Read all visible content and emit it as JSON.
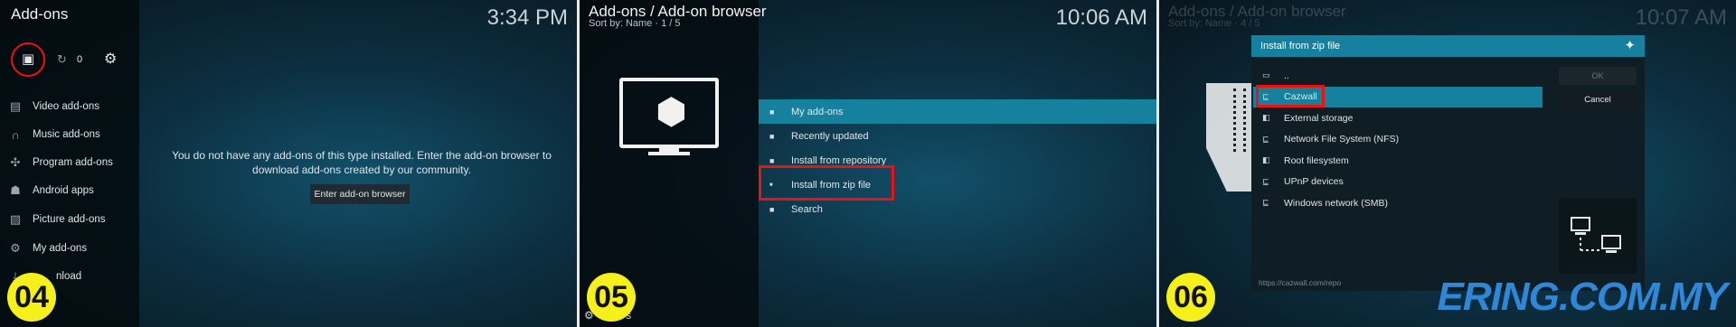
{
  "colors": {
    "accent": "#16809f",
    "highlight_red": "#e11111",
    "badge_yellow": "#f5ef1a",
    "brand_blue": "#2f87d8"
  },
  "panel1": {
    "title": "Add-ons",
    "clock": "3:34 PM",
    "update_count": "0",
    "nav": [
      {
        "label": "Video add-ons",
        "icon": "film-icon"
      },
      {
        "label": "Music add-ons",
        "icon": "headphones-icon"
      },
      {
        "label": "Program add-ons",
        "icon": "puzzle-icon"
      },
      {
        "label": "Android apps",
        "icon": "android-icon"
      },
      {
        "label": "Picture add-ons",
        "icon": "picture-icon"
      },
      {
        "label": "My add-ons",
        "icon": "gear-icon"
      },
      {
        "label": "nload",
        "icon": "download-icon"
      }
    ],
    "message": "You do not have any add-ons of this type installed. Enter the add-on browser to download add-ons created by our community.",
    "button": "Enter add-on browser",
    "step": "04"
  },
  "panel2": {
    "title": "Add-ons / Add-on browser",
    "subtitle": "Sort by: Name  ·  1 / 5",
    "clock": "10:06 AM",
    "items": [
      {
        "label": "My add-ons"
      },
      {
        "label": "Recently updated"
      },
      {
        "label": "Install from repository"
      },
      {
        "label": "Install from zip file"
      },
      {
        "label": "Search"
      }
    ],
    "bottom_fragment": "s",
    "step": "05"
  },
  "panel3": {
    "ghost_title": "Add-ons / Add-on browser",
    "ghost_subtitle": "Sort by: Name  ·  4 / 5",
    "clock": "10:07 AM",
    "dialog_title": "Install from zip file",
    "items": [
      {
        "label": ".."
      },
      {
        "label": "Cazwall"
      },
      {
        "label": "External storage"
      },
      {
        "label": "Network File System (NFS)"
      },
      {
        "label": "Root filesystem"
      },
      {
        "label": "UPnP devices"
      },
      {
        "label": "Windows network (SMB)"
      }
    ],
    "ok": "OK",
    "cancel": "Cancel",
    "path": "https://cazwall.com/repo",
    "step": "06",
    "watermark": "ERING.COM.MY"
  }
}
